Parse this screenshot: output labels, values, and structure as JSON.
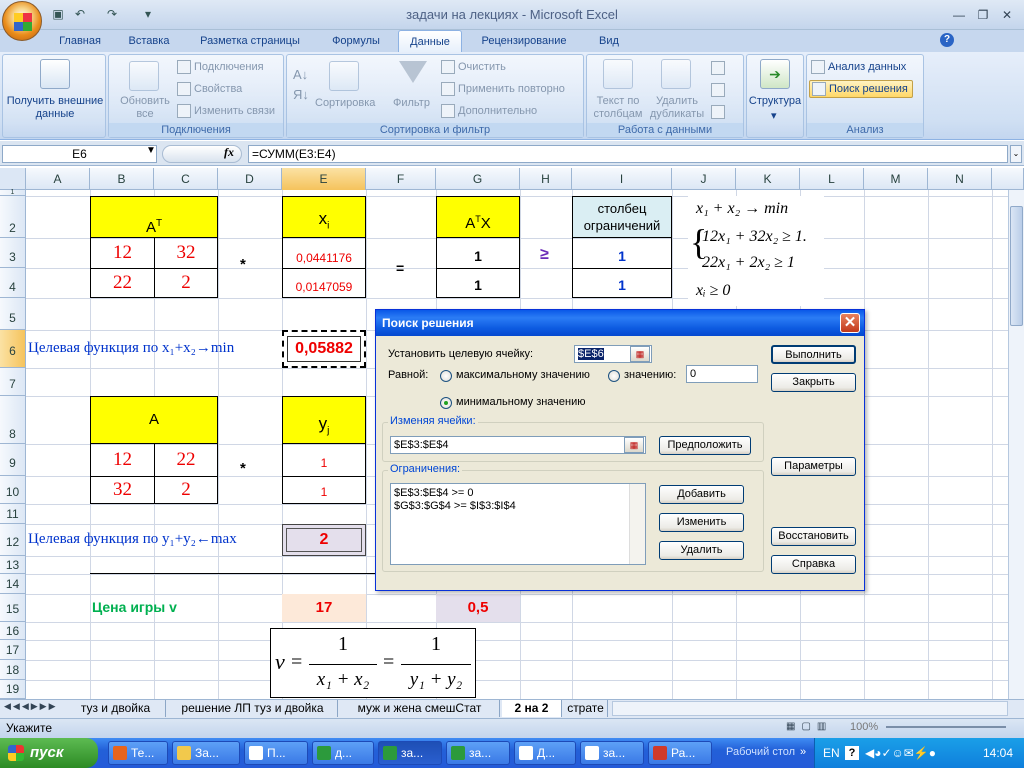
{
  "window": {
    "title": "задачи на лекциях - Microsoft Excel"
  },
  "tabs": [
    "Главная",
    "Вставка",
    "Разметка страницы",
    "Формулы",
    "Данные",
    "Рецензирование",
    "Вид"
  ],
  "ribbon": {
    "get_external": "Получить внешние данные",
    "refresh_all": "Обновить все",
    "connections": "Подключения",
    "properties": "Свойства",
    "edit_links": "Изменить связи",
    "group_connections": "Подключения",
    "sort": "Сортировка",
    "filter": "Фильтр",
    "clear": "Очистить",
    "reapply": "Применить повторно",
    "advanced": "Дополнительно",
    "group_sort": "Сортировка и фильтр",
    "text_to_columns": "Текст по столбцам",
    "remove_dups": "Удалить дубликаты",
    "group_data_tools": "Работа с данными",
    "structure": "Структура",
    "data_analysis": "Анализ данных",
    "solver": "Поиск решения",
    "group_analysis": "Анализ"
  },
  "formula_bar": {
    "name_box": "E6",
    "fx": "fx",
    "formula": "=СУММ(E3:E4)"
  },
  "columns": [
    "A",
    "B",
    "C",
    "D",
    "E",
    "F",
    "G",
    "H",
    "I",
    "J",
    "K",
    "L",
    "M",
    "N"
  ],
  "rows": [
    "1",
    "2",
    "3",
    "4",
    "5",
    "6",
    "7",
    "8",
    "9",
    "10",
    "11",
    "12",
    "13",
    "14",
    "15",
    "16",
    "17",
    "18",
    "19"
  ],
  "sheet": {
    "at_header": "A",
    "at_sup": "T",
    "matrix1": [
      "12",
      "32",
      "22",
      "2"
    ],
    "mult": "*",
    "xi_header": "x",
    "xi_sub": "i",
    "xi_values": [
      "0,0441176",
      "0,0147059"
    ],
    "eq": "=",
    "atx_header_a": "A",
    "atx_header_sup": "T",
    "atx_header_x": "X",
    "atx_values": [
      "1",
      "1"
    ],
    "geq": "≥",
    "constraint_header": "столбец ограничений",
    "constraint_values": [
      "1",
      "1"
    ],
    "system": {
      "l1": "x₁ + x₂ → min",
      "l2": "12x₁ + 32x₂ ≥ 1.",
      "l3": "22x₁ + 2x₂ ≥ 1",
      "l4": "xᵢ ≥ 0"
    },
    "goal1_label": "Целевая функция по x₁+x₂→min",
    "goal1_value": "0,05882",
    "a_header": "A",
    "matrix2": [
      "12",
      "22",
      "32",
      "2"
    ],
    "yj_header": "y",
    "yj_sub": "j",
    "yj_values": [
      "1",
      "1"
    ],
    "goal2_label": "Целевая функция по y₁+y₂←max",
    "goal2_value": "2",
    "price_label": "Цена игры v",
    "price_value1": "17",
    "price_value2": "0,5",
    "formula_nu": "ν",
    "formula_one": "1",
    "formula_den1": "x₁ + x₂",
    "formula_den2": "y₁ + y₂"
  },
  "dialog": {
    "title": "Поиск решения",
    "set_target": "Установить целевую ячейку:",
    "target_value": "$E$6",
    "equal_to": "Равной:",
    "max": "максимальному значению",
    "value": "значению:",
    "value_input": "0",
    "min": "минимальному значению",
    "changing": "Изменяя ячейки:",
    "changing_value": "$E$3:$E$4",
    "guess": "Предположить",
    "constraints": "Ограничения:",
    "constraint_list": [
      "$E$3:$E$4 >= 0",
      "$G$3:$G$4 >= $I$3:$I$4"
    ],
    "execute": "Выполнить",
    "close": "Закрыть",
    "options": "Параметры",
    "add": "Добавить",
    "change": "Изменить",
    "delete": "Удалить",
    "reset": "Восстановить",
    "help": "Справка"
  },
  "sheet_tabs": [
    "туз и двойка",
    "решение ЛП туз и двойка",
    "муж и жена смешСтат",
    "2 на 2",
    "страте"
  ],
  "status": {
    "text": "Укажите",
    "zoom": "100%"
  },
  "taskbar": {
    "start": "пуск",
    "items": [
      "Те...",
      "За...",
      "П...",
      "д...",
      "за...",
      "за...",
      "Д...",
      "за...",
      "Ра..."
    ],
    "desktop": "Рабочий стол",
    "lang": "EN",
    "time": "14:04"
  },
  "colors": {
    "accent": "#15428b",
    "yellow": "#ffff00",
    "red": "#e00000",
    "blue": "#0033cc",
    "green": "#00b050"
  }
}
